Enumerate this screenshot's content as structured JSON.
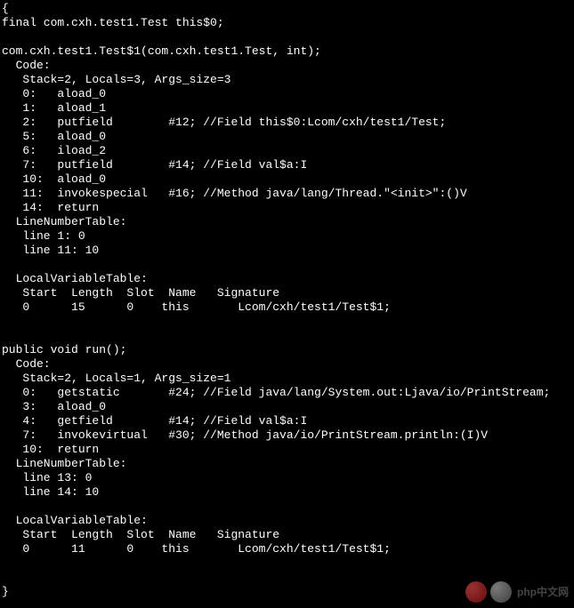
{
  "lines": [
    "{",
    "final com.cxh.test1.Test this$0;",
    "",
    "com.cxh.test1.Test$1(com.cxh.test1.Test, int);",
    "  Code:",
    "   Stack=2, Locals=3, Args_size=3",
    "   0:   aload_0",
    "   1:   aload_1",
    "   2:   putfield        #12; //Field this$0:Lcom/cxh/test1/Test;",
    "   5:   aload_0",
    "   6:   iload_2",
    "   7:   putfield        #14; //Field val$a:I",
    "   10:  aload_0",
    "   11:  invokespecial   #16; //Method java/lang/Thread.\"<init>\":()V",
    "   14:  return",
    "  LineNumberTable:",
    "   line 1: 0",
    "   line 11: 10",
    "",
    "  LocalVariableTable:",
    "   Start  Length  Slot  Name   Signature",
    "   0      15      0    this       Lcom/cxh/test1/Test$1;",
    "",
    "",
    "public void run();",
    "  Code:",
    "   Stack=2, Locals=1, Args_size=1",
    "   0:   getstatic       #24; //Field java/lang/System.out:Ljava/io/PrintStream;",
    "   3:   aload_0",
    "   4:   getfield        #14; //Field val$a:I",
    "   7:   invokevirtual   #30; //Method java/io/PrintStream.println:(I)V",
    "   10:  return",
    "  LineNumberTable:",
    "   line 13: 0",
    "   line 14: 10",
    "",
    "  LocalVariableTable:",
    "   Start  Length  Slot  Name   Signature",
    "   0      11      0    this       Lcom/cxh/test1/Test$1;",
    "",
    "",
    "}"
  ],
  "watermark": {
    "text": "php中文网"
  }
}
